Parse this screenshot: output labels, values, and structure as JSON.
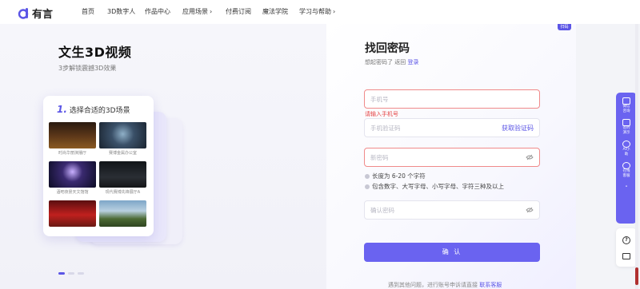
{
  "app": {
    "logo_text": "有言",
    "brand_color": "#5b55e6"
  },
  "nav": {
    "items": [
      {
        "label": "首页",
        "has_chevron": false
      },
      {
        "label": "3D数字人",
        "has_chevron": false
      },
      {
        "label": "作品中心",
        "has_chevron": false
      },
      {
        "label": "应用场景",
        "has_chevron": true
      },
      {
        "label": "付费订阅",
        "has_chevron": false
      },
      {
        "label": "魔法学院",
        "has_chevron": false
      },
      {
        "label": "学习与帮助",
        "has_chevron": true
      }
    ]
  },
  "hero": {
    "title": "文生3D视频",
    "subtitle": "3步解锁震撼3D效果",
    "card_step_num": "1.",
    "card_title": "选择合适的3D场景",
    "thumbnails": [
      {
        "label": "时尚华丽演播厅"
      },
      {
        "label": "赛博金属办公室"
      },
      {
        "label": "酒吧夜景天文馆馆"
      },
      {
        "label": "现代赛博先锋展厅A"
      },
      {
        "label": ""
      },
      {
        "label": ""
      }
    ]
  },
  "form": {
    "corner_tag": "扫码",
    "title": "找回密码",
    "subtitle_prefix": "想起密码了 返回",
    "subtitle_link": "登录",
    "phone_placeholder": "手机号",
    "phone_error": "请输入手机号",
    "code_placeholder": "手机验证码",
    "code_action": "获取验证码",
    "new_password_placeholder": "新密码",
    "rule_1": "长度为 6-20 个字符",
    "rule_2": "包含数字、大写字母、小写字母、字符三种及以上",
    "confirm_password_placeholder": "确认密码",
    "confirm_button": "确 认",
    "footer_prefix": "遇到其他问题，进行账号申诉请直接",
    "footer_link": "联系客服"
  },
  "float_bar": {
    "items": [
      {
        "label": "微信咨询",
        "icon": "chat-icon"
      },
      {
        "label": "签约演示",
        "icon": "screen-icon"
      },
      {
        "label": "AI小助",
        "icon": "robot-icon"
      },
      {
        "label": "在线客服",
        "icon": "headset-icon"
      }
    ],
    "bottom": [
      {
        "icon": "help-icon",
        "glyph": "?"
      },
      {
        "icon": "mail-icon",
        "glyph": ""
      }
    ]
  }
}
